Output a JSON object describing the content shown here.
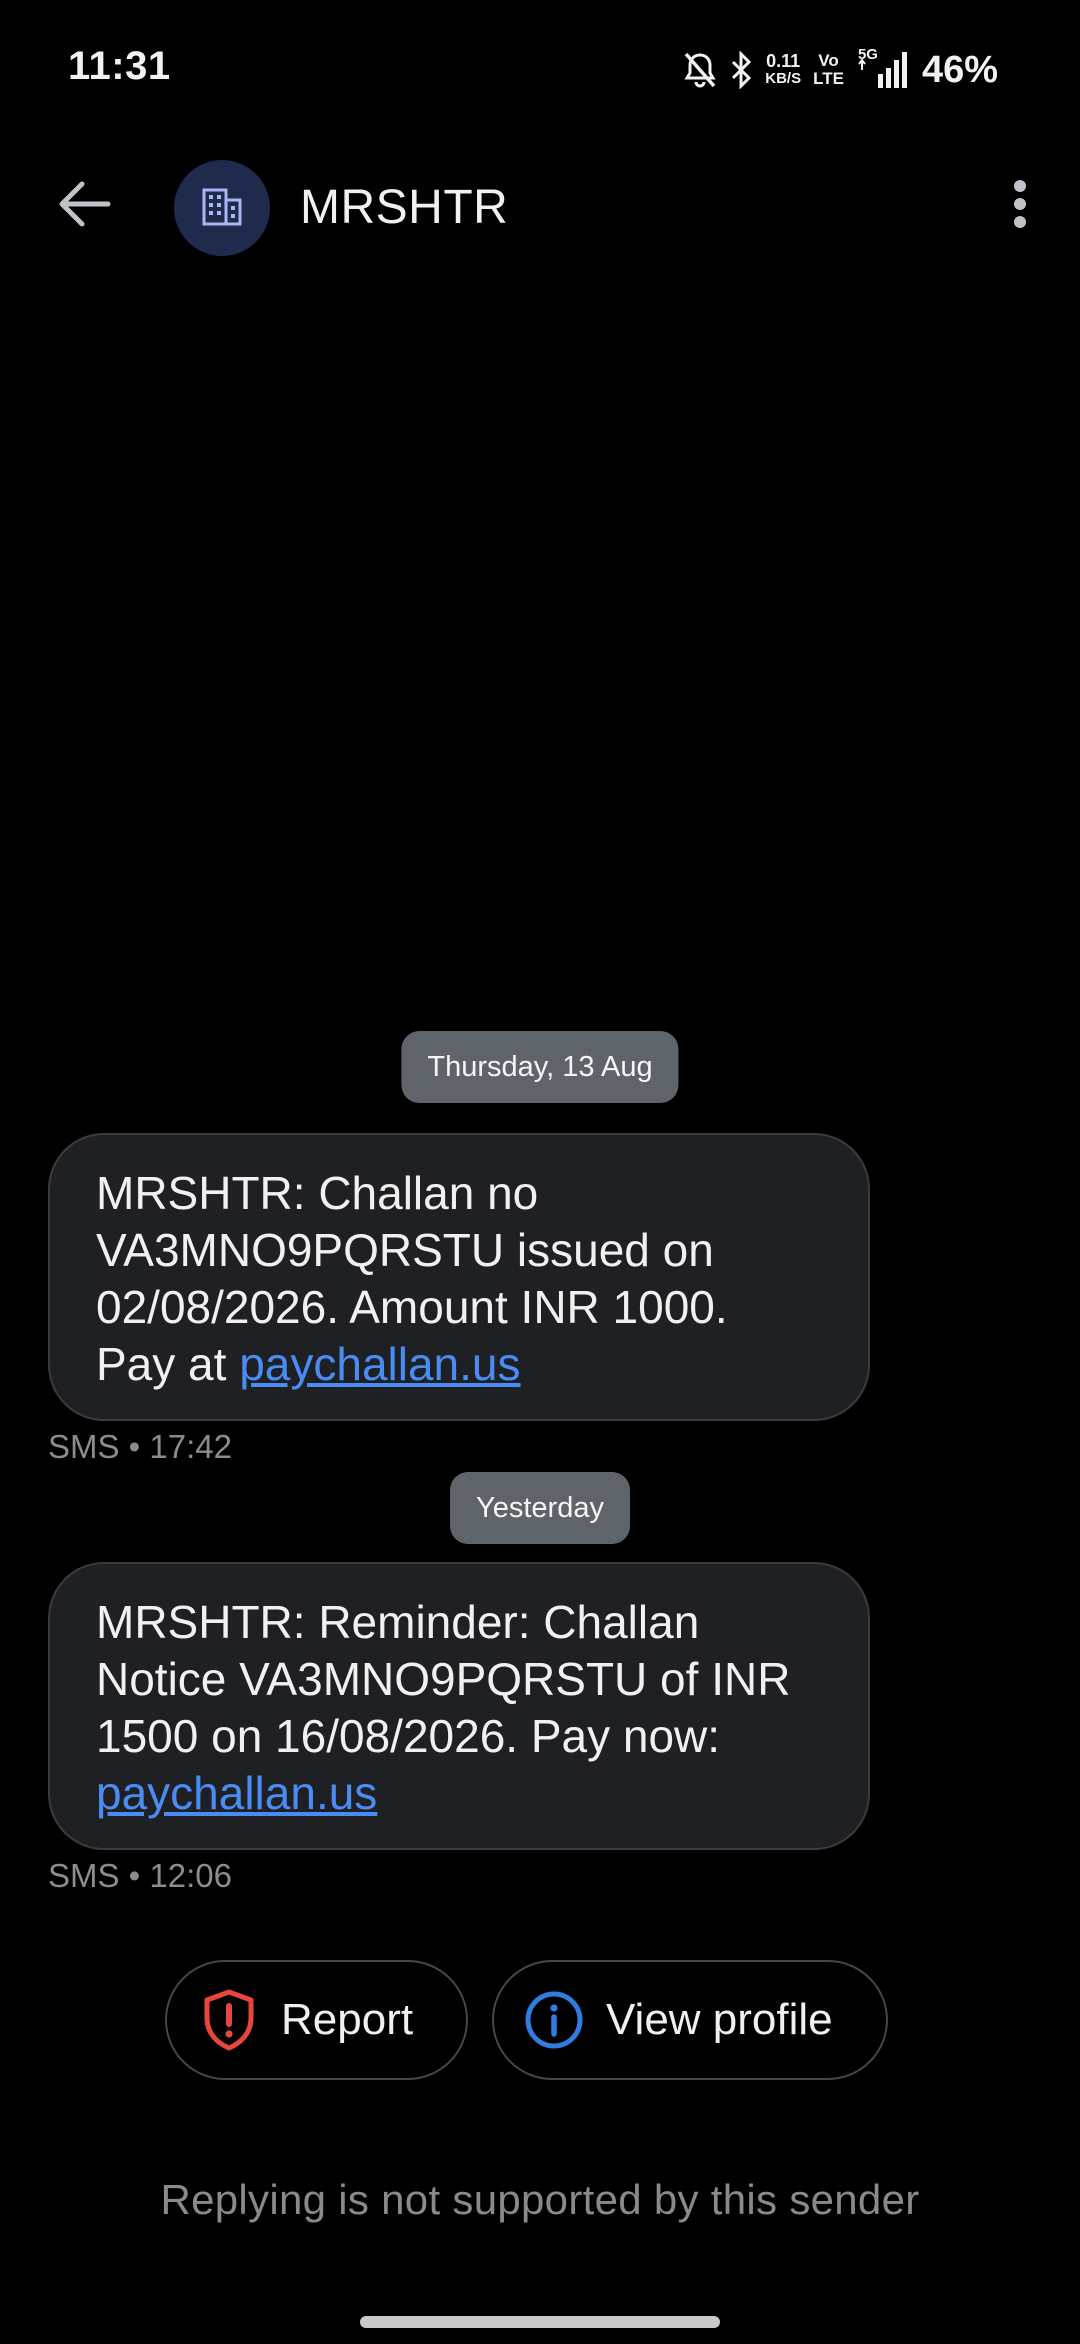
{
  "status_bar": {
    "time": "11:31",
    "net_speed_value": "0.11",
    "net_speed_unit": "KB/S",
    "volte_top": "Vo",
    "volte_bottom": "LTE",
    "network": "5G",
    "battery": "46%"
  },
  "header": {
    "sender": "MRSHTR",
    "avatar_icon": "building-icon",
    "back_icon": "arrow-back-icon",
    "menu_icon": "more-vertical-icon"
  },
  "conversation": {
    "groups": [
      {
        "date": "Thursday, 13 Aug",
        "message_lines": [
          "MRSHTR: Challan no",
          "VA3MNO9PQRSTU issued on",
          "02/08/2026. Amount INR 1000."
        ],
        "message_tail_prefix": "Pay at ",
        "link": "paychallan.us",
        "meta": "SMS • 17:42"
      },
      {
        "date": "Yesterday",
        "message_lines": [
          "MRSHTR: Reminder: Challan",
          "Notice VA3MNO9PQRSTU of INR",
          "1500 on 16/08/2026. Pay now:"
        ],
        "message_tail_prefix": "",
        "link": "paychallan.us",
        "meta": "SMS • 12:06"
      }
    ]
  },
  "actions": {
    "report_label": "Report",
    "report_icon": "shield-alert-icon",
    "profile_label": "View profile",
    "profile_icon": "info-icon"
  },
  "footer": {
    "reply_note": "Replying is not supported by this sender"
  },
  "colors": {
    "background": "#000000",
    "bubble": "#1f2023",
    "link": "#4a8cf5",
    "report_icon": "#e8453c",
    "info_icon": "#2f7de1"
  }
}
